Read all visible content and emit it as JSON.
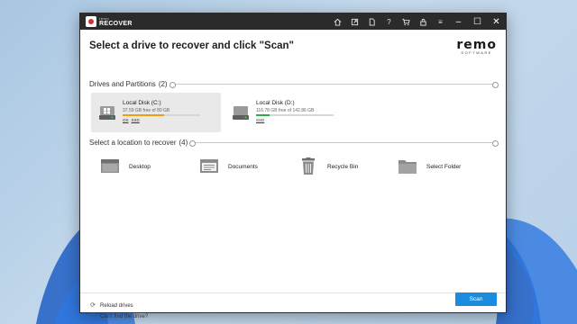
{
  "app": {
    "brand_small": "remo",
    "brand_name": "RECOVER",
    "title_icons": [
      "home-icon",
      "export-icon",
      "file-icon",
      "help-icon",
      "cart-icon",
      "lock-icon",
      "menu-icon"
    ],
    "window_controls": [
      "minimize-icon",
      "maximize-icon",
      "close-icon"
    ]
  },
  "header": {
    "title": "Select a drive to recover and click \"Scan\"",
    "logo_word": "remo",
    "logo_sub": "SOFTWARE"
  },
  "drives_section": {
    "label": "Drives and Partitions",
    "count": "(2)",
    "drives": [
      {
        "name": "Local Disk (C:)",
        "size_text": "37.59 GB free of 80 GB",
        "used_fraction": 0.53,
        "bar_color": "#f39c12",
        "tags": [
          "OS",
          "SSD"
        ],
        "selected": true
      },
      {
        "name": "Local Disk (D:)",
        "size_text": "116.78 GB free of 142.86 GB",
        "used_fraction": 0.18,
        "bar_color": "#2eaa4a",
        "tags": [
          "SSD"
        ],
        "selected": false
      }
    ]
  },
  "locations_section": {
    "label": "Select a location to recover",
    "count": "(4)",
    "items": [
      {
        "label": "Desktop",
        "icon": "desktop-icon"
      },
      {
        "label": "Documents",
        "icon": "documents-icon"
      },
      {
        "label": "Recycle Bin",
        "icon": "recycle-bin-icon"
      },
      {
        "label": "Select Folder",
        "icon": "folder-icon"
      }
    ]
  },
  "footer": {
    "reload_label": "Reload drives",
    "help_label": "Can't find the drive?",
    "scan_label": "Scan"
  },
  "colors": {
    "accent": "#1a8ce0",
    "titlebar": "#2b2b2b"
  }
}
